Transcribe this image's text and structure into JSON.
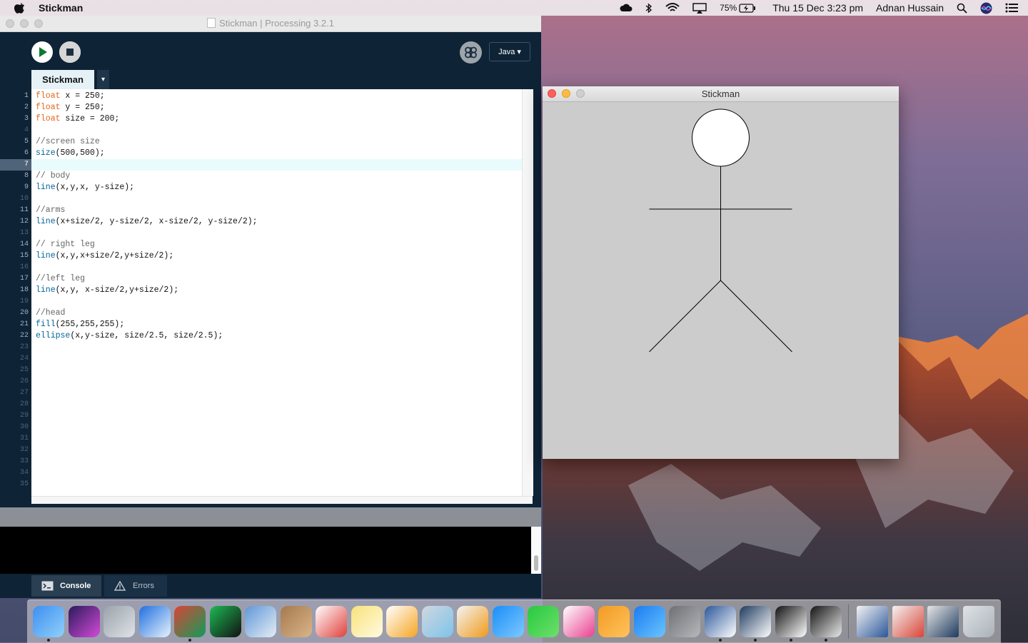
{
  "menubar": {
    "app_name": "Stickman",
    "battery": "75%",
    "datetime": "Thu 15 Dec  3:23 pm",
    "user": "Adnan Hussain"
  },
  "ide": {
    "window_title": "Stickman | Processing 3.2.1",
    "mode_label": "Java ▾",
    "tab_label": "Stickman",
    "tab_menu": "▾",
    "current_line": 7,
    "lines": [
      {
        "n": "1",
        "code": [
          {
            "t": "float",
            "c": "kw"
          },
          {
            "t": " x = 250;",
            "c": ""
          }
        ]
      },
      {
        "n": "2",
        "code": [
          {
            "t": "float",
            "c": "kw"
          },
          {
            "t": " y = 250;",
            "c": ""
          }
        ]
      },
      {
        "n": "3",
        "code": [
          {
            "t": "float",
            "c": "kw"
          },
          {
            "t": " size = 200;",
            "c": ""
          }
        ]
      },
      {
        "n": "4",
        "code": []
      },
      {
        "n": "5",
        "code": [
          {
            "t": "//screen size",
            "c": "cm"
          }
        ]
      },
      {
        "n": "6",
        "code": [
          {
            "t": "size",
            "c": "fn"
          },
          {
            "t": "(500,500);",
            "c": ""
          }
        ]
      },
      {
        "n": "7",
        "code": []
      },
      {
        "n": "8",
        "code": [
          {
            "t": "// body",
            "c": "cm"
          }
        ]
      },
      {
        "n": "9",
        "code": [
          {
            "t": "line",
            "c": "fn"
          },
          {
            "t": "(x,y,x, y-size);",
            "c": ""
          }
        ]
      },
      {
        "n": "10",
        "code": []
      },
      {
        "n": "11",
        "code": [
          {
            "t": "//arms",
            "c": "cm"
          }
        ]
      },
      {
        "n": "12",
        "code": [
          {
            "t": "line",
            "c": "fn"
          },
          {
            "t": "(x+size/2, y-size/2, x-size/2, y-size/2);",
            "c": ""
          }
        ]
      },
      {
        "n": "13",
        "code": []
      },
      {
        "n": "14",
        "code": [
          {
            "t": "// right leg",
            "c": "cm"
          }
        ]
      },
      {
        "n": "15",
        "code": [
          {
            "t": "line",
            "c": "fn"
          },
          {
            "t": "(x,y,x+size/2,y+size/2);",
            "c": ""
          }
        ]
      },
      {
        "n": "16",
        "code": []
      },
      {
        "n": "17",
        "code": [
          {
            "t": "//left leg",
            "c": "cm"
          }
        ]
      },
      {
        "n": "18",
        "code": [
          {
            "t": "line",
            "c": "fn"
          },
          {
            "t": "(x,y, x-size/2,y+size/2);",
            "c": ""
          }
        ]
      },
      {
        "n": "19",
        "code": []
      },
      {
        "n": "20",
        "code": [
          {
            "t": "//head",
            "c": "cm"
          }
        ]
      },
      {
        "n": "21",
        "code": [
          {
            "t": "fill",
            "c": "fn"
          },
          {
            "t": "(255,255,255);",
            "c": ""
          }
        ]
      },
      {
        "n": "22",
        "code": [
          {
            "t": "ellipse",
            "c": "fn"
          },
          {
            "t": "(x,y-size, size/2.5, size/2.5);",
            "c": ""
          }
        ]
      },
      {
        "n": "23",
        "code": []
      },
      {
        "n": "24",
        "code": []
      },
      {
        "n": "25",
        "code": []
      },
      {
        "n": "26",
        "code": []
      },
      {
        "n": "27",
        "code": []
      },
      {
        "n": "28",
        "code": []
      },
      {
        "n": "29",
        "code": []
      },
      {
        "n": "30",
        "code": []
      },
      {
        "n": "31",
        "code": []
      },
      {
        "n": "32",
        "code": []
      },
      {
        "n": "33",
        "code": []
      },
      {
        "n": "34",
        "code": []
      },
      {
        "n": "35",
        "code": []
      }
    ],
    "console_tab": "Console",
    "errors_tab": "Errors"
  },
  "sketch": {
    "window_title": "Stickman"
  },
  "dock": {
    "items": [
      {
        "icon": "finder-icon",
        "colors": [
          "#3e8ff0",
          "#8fd0fb"
        ],
        "running": true
      },
      {
        "icon": "siri-icon",
        "colors": [
          "#2a1a5c",
          "#d44ad8"
        ],
        "running": false
      },
      {
        "icon": "launchpad-icon",
        "colors": [
          "#9aa2ab",
          "#dfe3e7"
        ],
        "running": false
      },
      {
        "icon": "safari-icon",
        "colors": [
          "#1f6fe0",
          "#e6f2fb"
        ],
        "running": false
      },
      {
        "icon": "chrome-icon",
        "colors": [
          "#db4437",
          "#0f9d58"
        ],
        "running": true
      },
      {
        "icon": "spotify-icon",
        "colors": [
          "#1db954",
          "#111111"
        ],
        "running": false
      },
      {
        "icon": "preview-icon",
        "colors": [
          "#5f97d8",
          "#e6edf4"
        ],
        "running": false
      },
      {
        "icon": "contacts-icon",
        "colors": [
          "#a7794d",
          "#d9b48a"
        ],
        "running": false
      },
      {
        "icon": "calendar-icon",
        "colors": [
          "#ffffff",
          "#e0403a"
        ],
        "running": false
      },
      {
        "icon": "notes-icon",
        "colors": [
          "#f8e27a",
          "#fffbe0"
        ],
        "running": false
      },
      {
        "icon": "reminders-icon",
        "colors": [
          "#ffffff",
          "#f5a623"
        ],
        "running": false
      },
      {
        "icon": "photo-booth-icon",
        "colors": [
          "#d0d7df",
          "#7ec3ea"
        ],
        "running": false
      },
      {
        "icon": "photos-icon",
        "colors": [
          "#f4f4f4",
          "#f09a1a"
        ],
        "running": false
      },
      {
        "icon": "messages-icon",
        "colors": [
          "#1a8ef7",
          "#7dc8ff"
        ],
        "running": false
      },
      {
        "icon": "facetime-icon",
        "colors": [
          "#27c93f",
          "#6ee06b"
        ],
        "running": false
      },
      {
        "icon": "itunes-icon",
        "colors": [
          "#ffffff",
          "#e8408f"
        ],
        "running": false
      },
      {
        "icon": "ibooks-icon",
        "colors": [
          "#f39a23",
          "#ffc35c"
        ],
        "running": false
      },
      {
        "icon": "app-store-icon",
        "colors": [
          "#1b7cf0",
          "#69c5ff"
        ],
        "running": false
      },
      {
        "icon": "system-preferences-icon",
        "colors": [
          "#6d6f73",
          "#b6b8bb"
        ],
        "running": false
      },
      {
        "icon": "word-icon",
        "colors": [
          "#2b579a",
          "#ffffff"
        ],
        "running": true
      },
      {
        "icon": "remote-desktop-icon",
        "colors": [
          "#1e3a5f",
          "#ffffff"
        ],
        "running": true
      },
      {
        "icon": "processing-icon",
        "colors": [
          "#111111",
          "#ffffff"
        ],
        "running": true
      },
      {
        "icon": "quicktime-icon",
        "colors": [
          "#141414",
          "#e8e8e8"
        ],
        "running": true
      }
    ],
    "extra_items": [
      {
        "icon": "word-document-thumbnail-icon",
        "colors": [
          "#f3f3f3",
          "#2b579a"
        ]
      },
      {
        "icon": "chrome-window-thumbnail-icon",
        "colors": [
          "#f3f3f3",
          "#db4437"
        ]
      },
      {
        "icon": "remote-window-thumbnail-icon",
        "colors": [
          "#e6e6e6",
          "#1e3a5f"
        ]
      },
      {
        "icon": "trash-icon",
        "colors": [
          "#dfe3e7",
          "#aab1b8"
        ]
      }
    ]
  },
  "colors": {
    "ide_bg": "#0e2336",
    "keyword": "#e2661a",
    "function": "#006699",
    "comment": "#666666",
    "sketch_bg": "#cccccc"
  }
}
